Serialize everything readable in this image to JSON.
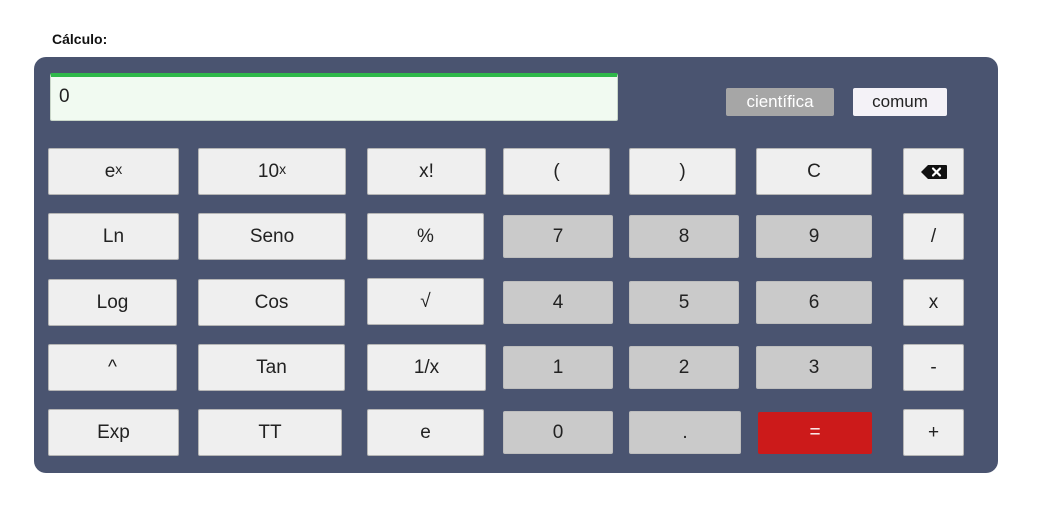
{
  "title": "Cálculo:",
  "display": {
    "value": "0"
  },
  "modes": {
    "scientific": "científica",
    "common": "comum"
  },
  "keys": {
    "ex_base": "e",
    "ex_sup": "x",
    "tenx_base": "10",
    "tenx_sup": "x",
    "fact": "x!",
    "lparen": "(",
    "rparen": ")",
    "clear": "C",
    "ln": "Ln",
    "sin": "Seno",
    "pct": "%",
    "n7": "7",
    "n8": "8",
    "n9": "9",
    "div": "/",
    "log": "Log",
    "cos": "Cos",
    "sqrt": "√",
    "n4": "4",
    "n5": "5",
    "n6": "6",
    "mul": "x",
    "pow": "^",
    "tan": "Tan",
    "inv": "1/x",
    "n1": "1",
    "n2": "2",
    "n3": "3",
    "sub": "-",
    "exp": "Exp",
    "pi": "TT",
    "e": "e",
    "n0": "0",
    "dot": ".",
    "eq": "=",
    "add": "+",
    "backspace_icon": "backspace-icon"
  },
  "colors": {
    "panel": "#4a5470",
    "display_bg": "#f1faf1",
    "display_accent": "#2fb84a",
    "equals": "#cc1a1a",
    "number_key": "#cacaca",
    "function_key": "#efefef"
  }
}
